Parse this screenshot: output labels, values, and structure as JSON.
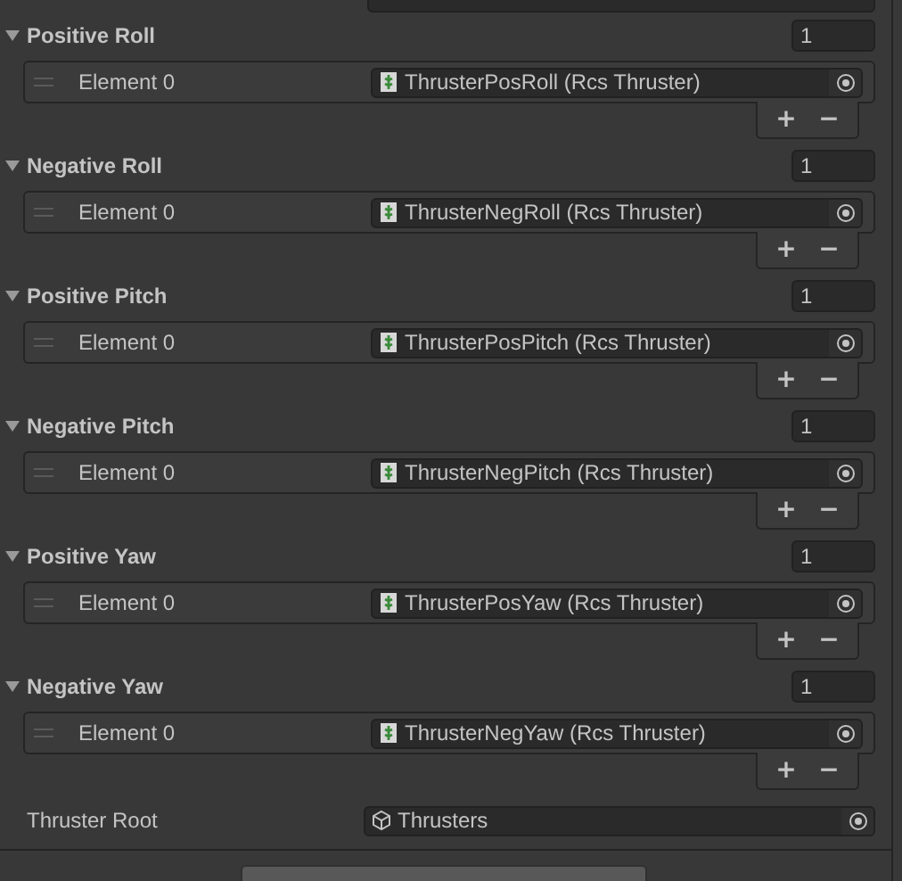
{
  "lists": [
    {
      "label": "Positive Roll",
      "expanded": true,
      "count": "1",
      "elements": [
        {
          "label": "Element 0",
          "value": "ThrusterPosRoll (Rcs Thruster)"
        }
      ],
      "footer_buttons": [
        "+",
        "−"
      ]
    },
    {
      "label": "Negative Roll",
      "expanded": true,
      "count": "1",
      "elements": [
        {
          "label": "Element 0",
          "value": "ThrusterNegRoll (Rcs Thruster)"
        }
      ],
      "footer_buttons": [
        "+",
        "−"
      ]
    },
    {
      "label": "Positive Pitch",
      "expanded": true,
      "count": "1",
      "elements": [
        {
          "label": "Element 0",
          "value": "ThrusterPosPitch (Rcs Thruster)"
        }
      ],
      "footer_buttons": [
        "+",
        "−"
      ]
    },
    {
      "label": "Negative Pitch",
      "expanded": true,
      "count": "1",
      "elements": [
        {
          "label": "Element 0",
          "value": "ThrusterNegPitch (Rcs Thruster)"
        }
      ],
      "footer_buttons": [
        "+",
        "−"
      ]
    },
    {
      "label": "Positive Yaw",
      "expanded": true,
      "count": "1",
      "elements": [
        {
          "label": "Element 0",
          "value": "ThrusterPosYaw (Rcs Thruster)"
        }
      ],
      "footer_buttons": [
        "+",
        "−"
      ]
    },
    {
      "label": "Negative Yaw",
      "expanded": true,
      "count": "1",
      "elements": [
        {
          "label": "Element 0",
          "value": "ThrusterNegYaw (Rcs Thruster)"
        }
      ],
      "footer_buttons": [
        "+",
        "−"
      ]
    }
  ],
  "thruster_root": {
    "label": "Thruster Root",
    "value": "Thrusters"
  }
}
